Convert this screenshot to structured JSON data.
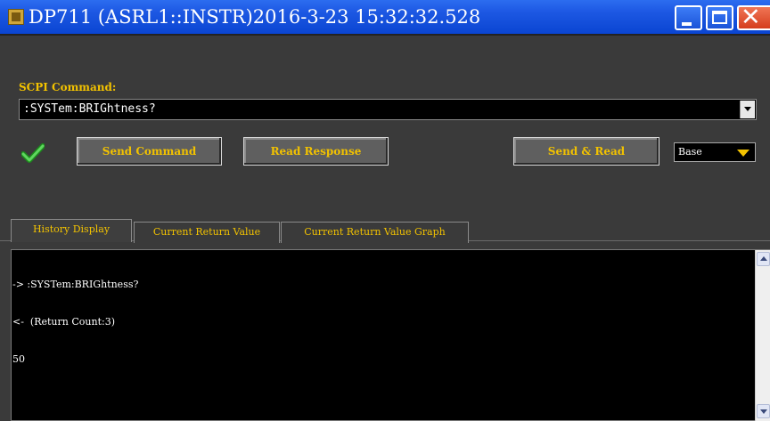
{
  "window": {
    "title": "DP711  (ASRL1::INSTR)2016-3-23  15:32:32.528"
  },
  "scpi": {
    "label": "SCPI Command:",
    "command_value": ":SYSTem:BRIGhtness?"
  },
  "toolbar": {
    "send_label": "Send Command",
    "read_label": "Read Response",
    "send_read_label": "Send & Read",
    "base_value": "Base"
  },
  "tabs": [
    {
      "label": "History Display",
      "active": true
    },
    {
      "label": "Current Return Value",
      "active": false
    },
    {
      "label": "Current Return Value Graph",
      "active": false
    }
  ],
  "history": {
    "lines": [
      "-> :SYSTem:BRIGhtness?",
      "<-  (Return Count:3)",
      "50"
    ]
  },
  "colors": {
    "titlebar": "#1d58e3",
    "accent_text": "#f2c200",
    "background": "#3a3a3a",
    "panel": "#000000"
  },
  "icons": [
    "app-icon",
    "minimize-icon",
    "maximize-icon",
    "close-icon",
    "checkmark-icon",
    "dropdown-arrow-icon",
    "scroll-up-icon",
    "scroll-down-icon"
  ]
}
